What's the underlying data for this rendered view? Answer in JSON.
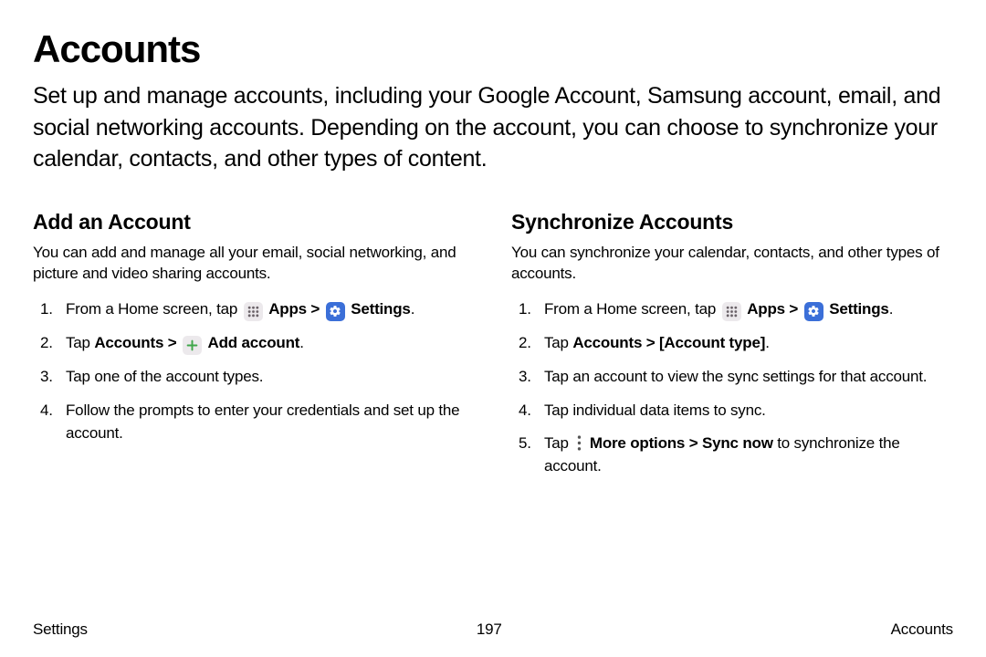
{
  "title": "Accounts",
  "intro": "Set up and manage accounts, including your Google Account, Samsung account, email, and social networking accounts. Depending on the account, you can choose to synchronize your calendar, contacts, and other types of content.",
  "left": {
    "heading": "Add an Account",
    "intro": "You can add and manage all your email, social networking, and picture and video sharing accounts.",
    "step1_pre": "From a Home screen, tap ",
    "apps_label": "Apps",
    "sep": " > ",
    "settings_label": "Settings",
    "period": ".",
    "step2_pre": "Tap ",
    "step2_accounts": "Accounts > ",
    "step2_add": "Add account",
    "step3": "Tap one of the account types.",
    "step4": "Follow the prompts to enter your credentials and set up the account."
  },
  "right": {
    "heading": "Synchronize Accounts",
    "intro": "You can synchronize your calendar, contacts, and other types of accounts.",
    "step1_pre": "From a Home screen, tap ",
    "apps_label": "Apps",
    "sep": " > ",
    "settings_label": "Settings",
    "period": ".",
    "step2_pre": "Tap ",
    "step2_bold": "Accounts > [Account type]",
    "step3": "Tap an account to view the sync settings for that account.",
    "step4": "Tap individual data items to sync.",
    "step5_pre": "Tap ",
    "step5_bold": "More options > Sync now",
    "step5_post": " to synchronize the account."
  },
  "footer": {
    "left": "Settings",
    "center": "197",
    "right": "Accounts"
  }
}
